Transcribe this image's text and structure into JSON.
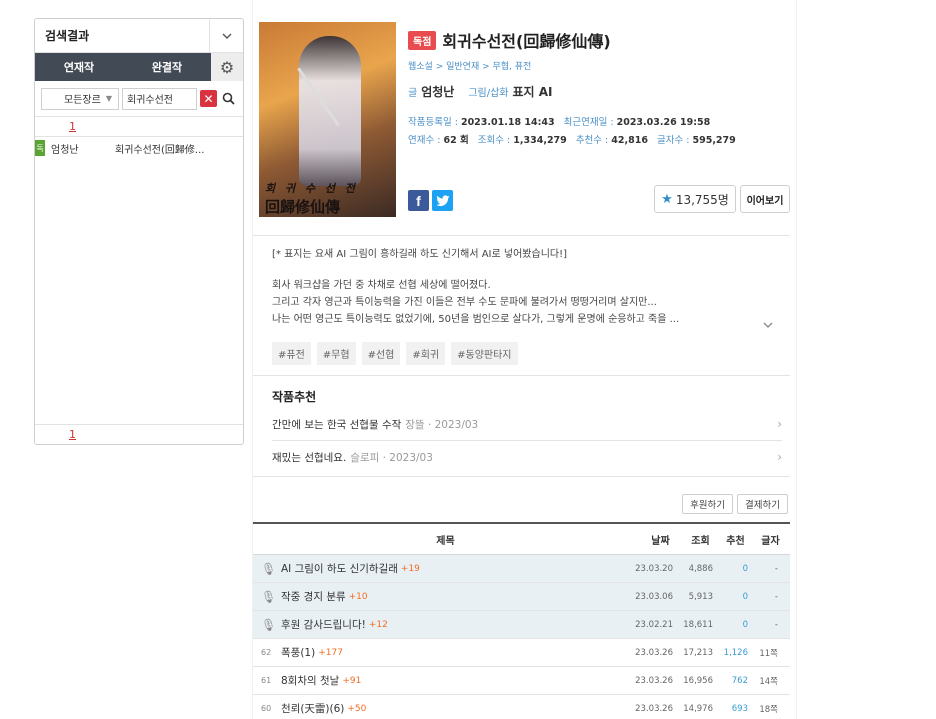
{
  "sidebar": {
    "title": "검색결과",
    "tabs": [
      "연재작",
      "완결작"
    ],
    "genre_select": "모든장르",
    "search_value": "회귀수선전",
    "page_top": "1",
    "page_bottom": "1",
    "results": [
      {
        "badge": "독",
        "author": "엄청난",
        "title": "회귀수선전(回歸修..."
      }
    ]
  },
  "novel": {
    "badge": "독점",
    "title": "회귀수선전(回歸修仙傳)",
    "genre": "웹소설 > 일반연재 > 무협, 퓨전",
    "author_label": "글",
    "author": "엄청난",
    "illust_label": "그림/삽화",
    "illustrator": "표지 AI",
    "reg_label": "작품등록일 :",
    "reg_date": "2023.01.18 14:43",
    "latest_label": "최근연재일 :",
    "latest_date": "2023.03.26 19:58",
    "episodes_label": "연재수 :",
    "episodes": "62 회",
    "views_label": "조회수 :",
    "views": "1,334,279",
    "recs_label": "추천수 :",
    "recs": "42,816",
    "chars_label": "글자수 :",
    "chars": "595,279",
    "fav_count": "13,755명",
    "continue_label": "이어보기",
    "cover_line1": "회 귀 수 선 전",
    "cover_line2": "回歸修仙傳"
  },
  "synopsis": {
    "line1": "[* 표지는 요새 AI 그림이 흥하길래 하도 신기해서 AI로 넣어봤습니다!]",
    "line2": "회사 워크샵을 가던 중 차채로 선협 세상에 떨어졌다.",
    "line3": "그리고 각자 영근과 특이능력을 가진 이들은 전부 수도 문파에 불려가서 떵떵거리며 살지만...",
    "line4": "나는 어떤 영근도 특이능력도 없었기에, 50년을 범인으로 살다가, 그렇게 운명에 순응하고 죽을 ..."
  },
  "tags": [
    "#퓨전",
    "#무협",
    "#선협",
    "#회귀",
    "#동양판타지"
  ],
  "recommend": {
    "title": "작품추천",
    "items": [
      {
        "text": "간만에 보는 한국 선협물 수작",
        "meta": "장뜰 · 2023/03"
      },
      {
        "text": "재밌는 선협네요.",
        "meta": "슬로피 · 2023/03"
      }
    ]
  },
  "actions": {
    "sponsor": "후원하기",
    "pay": "결제하기"
  },
  "table": {
    "headers": {
      "title": "제목",
      "date": "날짜",
      "views": "조회",
      "recs": "추천",
      "chars": "글자"
    },
    "rows": [
      {
        "no": "",
        "title": "AI 그림이 하도 신기하길래",
        "plus": "+19",
        "date": "23.03.20",
        "views": "4,886",
        "recs": "0",
        "chars": "-",
        "notice": true
      },
      {
        "no": "",
        "title": "작중 경지 분류",
        "plus": "+10",
        "date": "23.03.06",
        "views": "5,913",
        "recs": "0",
        "chars": "-",
        "notice": true
      },
      {
        "no": "",
        "title": "후원 감사드립니다!",
        "plus": "+12",
        "date": "23.02.21",
        "views": "18,611",
        "recs": "0",
        "chars": "-",
        "notice": true
      },
      {
        "no": "62",
        "title": "폭풍(1)",
        "plus": "+177",
        "date": "23.03.26",
        "views": "17,213",
        "recs": "1,126",
        "chars": "11쪽",
        "notice": false
      },
      {
        "no": "61",
        "title": "8회차의 첫날",
        "plus": "+91",
        "date": "23.03.26",
        "views": "16,956",
        "recs": "762",
        "chars": "14쪽",
        "notice": false
      },
      {
        "no": "60",
        "title": "천뢰(天雷)(6)",
        "plus": "+50",
        "date": "23.03.26",
        "views": "14,976",
        "recs": "693",
        "chars": "18쪽",
        "notice": false
      }
    ]
  },
  "colors": {
    "accent_red": "#e84c4f",
    "link_blue": "#4a90c8",
    "tab_dark": "#414a55",
    "plus_orange": "#f26c22",
    "rec_blue": "#3b9bd1",
    "notice_bg": "#e8f0f4"
  }
}
